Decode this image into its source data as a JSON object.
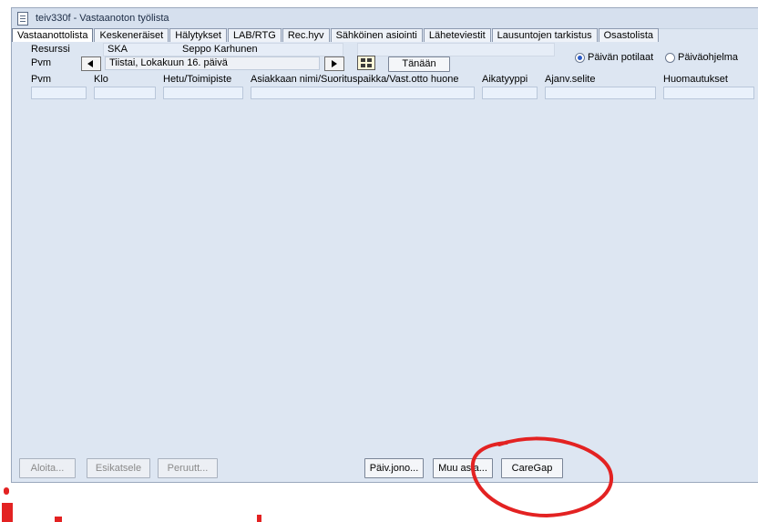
{
  "window": {
    "title": "teiv330f - Vastaanoton työlista"
  },
  "tabs": [
    {
      "label": "Vastaanottolista",
      "active": true
    },
    {
      "label": "Keskeneräiset"
    },
    {
      "label": "Hälytykset"
    },
    {
      "label": "LAB/RTG"
    },
    {
      "label": "Rec.hyv"
    },
    {
      "label": "Sähköinen asiointi"
    },
    {
      "label": "Läheteviestit"
    },
    {
      "label": "Lausuntojen tarkistus"
    },
    {
      "label": "Osastolista"
    }
  ],
  "resource": {
    "label": "Resurssi",
    "code": "SKA",
    "name": "Seppo Karhunen"
  },
  "date": {
    "label": "Pvm",
    "value": "Tiistai, Lokakuun 16. päivä",
    "today_button": "Tänään"
  },
  "view_options": [
    {
      "label": "Päivän potilaat",
      "selected": true
    },
    {
      "label": "Päiväohjelma",
      "selected": false
    }
  ],
  "columns": [
    "Pvm",
    "Klo",
    "Hetu/Toimipiste",
    "Asiakkaan nimi/Suorituspaikka/Vast.otto huone",
    "Aikatyyppi",
    "Ajanv.selite",
    "Huomautukset"
  ],
  "buttons": {
    "start": "Aloita...",
    "preview": "Esikatsele",
    "cancel": "Peruutt...",
    "day_queue": "Päiv.jono...",
    "other": "Muu asia...",
    "caregap": "CareGap"
  },
  "colors": {
    "annotation": "#e32222",
    "window_bg": "#dde6f2"
  }
}
